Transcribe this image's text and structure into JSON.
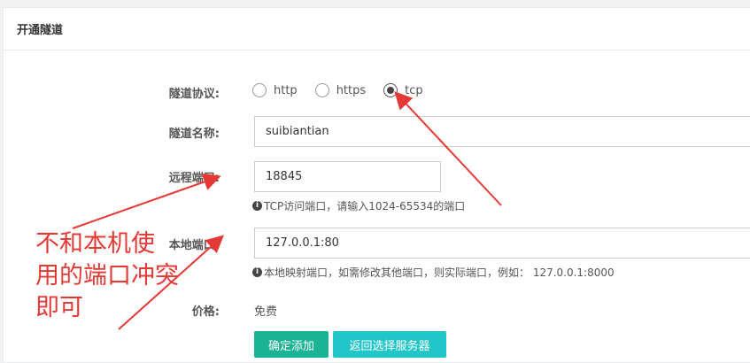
{
  "panel": {
    "title": "开通隧道"
  },
  "protocol": {
    "label": "隧道协议:",
    "options": [
      "http",
      "https",
      "tcp"
    ],
    "selected": "tcp"
  },
  "tunnel_name": {
    "label": "隧道名称:",
    "value": "suibiantian"
  },
  "remote_port": {
    "label": "远程端口:",
    "value": "18845",
    "hint": "TCP访问端口，请输入1024-65534的端口"
  },
  "local_port": {
    "label": "本地端口:",
    "value": "127.0.0.1:80",
    "hint": "本地映射端口，如需修改其他端口，则实际端口，例如：  127.0.0.1:8000"
  },
  "price": {
    "label": "价格:",
    "value": "免费"
  },
  "buttons": {
    "confirm": "确定添加",
    "back": "返回选择服务器"
  },
  "annotation": {
    "text": "不和本机使用的端口冲突即可",
    "lines": [
      "不和本机使",
      "用的端口冲突",
      "即可"
    ],
    "color": "#e53935"
  },
  "colors": {
    "primary": "#1ab394",
    "info": "#23c6c8",
    "annotation": "#e53935"
  }
}
